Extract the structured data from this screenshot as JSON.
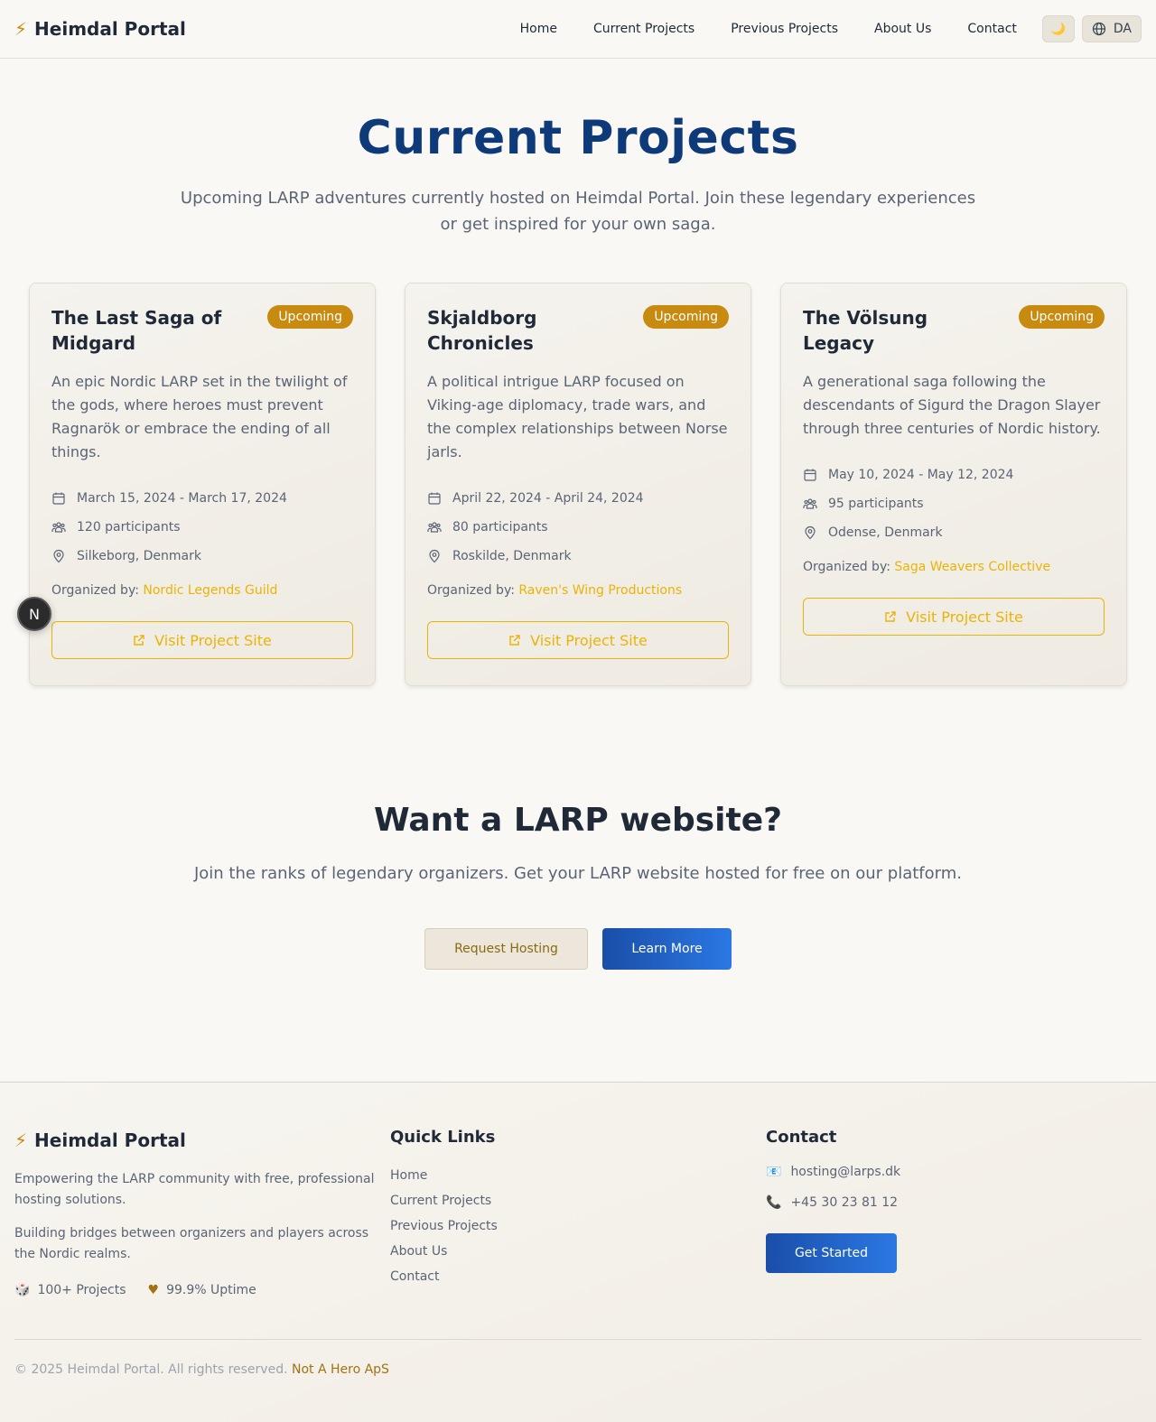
{
  "header": {
    "brand_icon": "⚡",
    "brand_name": "Heimdal Portal",
    "nav": [
      "Home",
      "Current Projects",
      "Previous Projects",
      "About Us",
      "Contact"
    ],
    "theme_icon": "🌙",
    "lang_label": "DA"
  },
  "hero": {
    "title": "Current Projects",
    "subtitle": "Upcoming LARP adventures currently hosted on Heimdal Portal. Join these legendary experiences or get inspired for your own saga."
  },
  "projects": [
    {
      "title": "The Last Saga of Midgard",
      "status": "Upcoming",
      "description": "An epic Nordic LARP set in the twilight of the gods, where heroes must prevent Ragnarök or embrace the ending of all things.",
      "dates": "March 15, 2024 - March 17, 2024",
      "participants": "120 participants",
      "location": "Silkeborg, Denmark",
      "organized_label": "Organized by:",
      "organizer": "Nordic Legends Guild",
      "visit_label": "Visit Project Site"
    },
    {
      "title": "Skjaldborg Chronicles",
      "status": "Upcoming",
      "description": "A political intrigue LARP focused on Viking-age diplomacy, trade wars, and the complex relationships between Norse jarls.",
      "dates": "April 22, 2024 - April 24, 2024",
      "participants": "80 participants",
      "location": "Roskilde, Denmark",
      "organized_label": "Organized by:",
      "organizer": "Raven's Wing Productions",
      "visit_label": "Visit Project Site"
    },
    {
      "title": "The Völsung Legacy",
      "status": "Upcoming",
      "description": "A generational saga following the descendants of Sigurd the Dragon Slayer through three centuries of Nordic history.",
      "dates": "May 10, 2024 - May 12, 2024",
      "participants": "95 participants",
      "location": "Odense, Denmark",
      "organized_label": "Organized by:",
      "organizer": "Saga Weavers Collective",
      "visit_label": "Visit Project Site"
    }
  ],
  "floating_badge": "N",
  "cta": {
    "title": "Want a LARP website?",
    "subtitle": "Join the ranks of legendary organizers. Get your LARP website hosted for free on our platform.",
    "request_label": "Request Hosting",
    "learn_label": "Learn More"
  },
  "footer": {
    "brand_icon": "⚡",
    "brand_name": "Heimdal Portal",
    "desc1": "Empowering the LARP community with free, professional hosting solutions.",
    "desc2": "Building bridges between organizers and players across the Nordic realms.",
    "stat1_icon": "🎲",
    "stat1": "100+ Projects",
    "stat2_icon": "♥",
    "stat2": "99.9% Uptime",
    "quick_links_title": "Quick Links",
    "quick_links": [
      "Home",
      "Current Projects",
      "Previous Projects",
      "About Us",
      "Contact"
    ],
    "contact_title": "Contact",
    "email_icon": "📧",
    "email": "hosting@larps.dk",
    "phone_icon": "📞",
    "phone": "+45 30 23 81 12",
    "get_started_label": "Get Started",
    "copyright": "© 2025 Heimdal Portal. All rights reserved.",
    "company": "Not A Hero ApS"
  },
  "colors": {
    "accent_gold": "#c98a10",
    "link_yellow": "#eab308",
    "title_blue": "#0f3a7a",
    "button_blue": "#1a4ea8"
  }
}
